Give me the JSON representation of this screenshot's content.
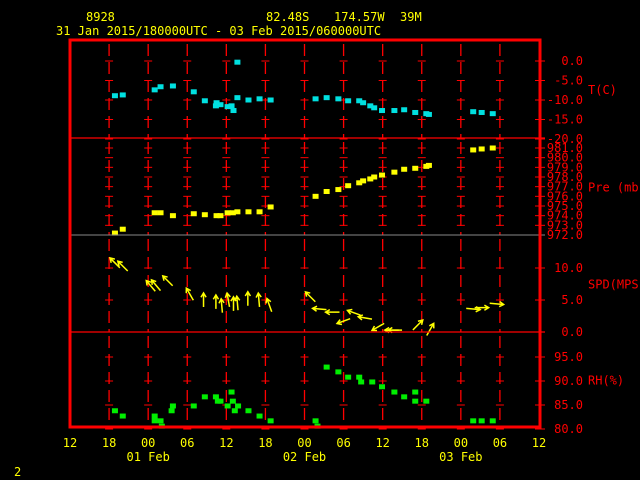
{
  "header": {
    "station": "8928",
    "latitude": "82.48S",
    "longitude": "174.57W",
    "elevation": "39M",
    "period": "31 Jan 2015/180000UTC - 03 Feb 2015/060000UTC"
  },
  "footer": {
    "page": "2"
  },
  "colors": {
    "frame": "#ff0000",
    "text": "#ffff00",
    "temperature": "#00e0e0",
    "pressure": "#ffff00",
    "wind": "#ffff00",
    "humidity": "#00ee00"
  },
  "chart_data": {
    "type": "scatter",
    "x_axis": {
      "range": [
        "2015-01-31 12:00",
        "2015-02-03 12:00"
      ],
      "tick_labels": [
        "12",
        "18",
        "00",
        "06",
        "12",
        "18",
        "00",
        "06",
        "12",
        "18",
        "00",
        "06",
        "12"
      ],
      "date_labels": [
        {
          "date": "2015-02-01 00:00",
          "label": "01 Feb"
        },
        {
          "date": "2015-02-02 00:00",
          "label": "02 Feb"
        },
        {
          "date": "2015-02-03 00:00",
          "label": "03 Feb"
        }
      ]
    },
    "panels": [
      {
        "key": "temperature",
        "ylabel": "T(C)",
        "ylim": [
          -20,
          0
        ],
        "ticks": [
          "0.0",
          "-5.0",
          "-10.0",
          "-15.0",
          "-20.0"
        ],
        "tick_values": [
          0,
          -5,
          -10,
          -15,
          -20
        ],
        "marker": "square",
        "points": [
          [
            "2015-01-31 18:54",
            -8.9
          ],
          [
            "2015-01-31 20:06",
            -8.7
          ],
          [
            "2015-02-01 01:00",
            -7.4
          ],
          [
            "2015-02-01 01:54",
            -6.6
          ],
          [
            "2015-02-01 03:48",
            -6.4
          ],
          [
            "2015-02-01 07:00",
            -7.9
          ],
          [
            "2015-02-01 08:42",
            -10.2
          ],
          [
            "2015-02-01 10:30",
            -10.7
          ],
          [
            "2015-02-01 10:24",
            -11.5
          ],
          [
            "2015-02-01 11:06",
            -11.2
          ],
          [
            "2015-02-01 12:12",
            -11.7
          ],
          [
            "2015-02-01 12:48",
            -11.5
          ],
          [
            "2015-02-01 13:06",
            -12.7
          ],
          [
            "2015-02-01 13:42",
            -0.3
          ],
          [
            "2015-02-01 13:42",
            -9.4
          ],
          [
            "2015-02-01 15:24",
            -10.0
          ],
          [
            "2015-02-01 17:06",
            -9.7
          ],
          [
            "2015-02-01 18:48",
            -10.0
          ],
          [
            "2015-02-02 01:42",
            -9.7
          ],
          [
            "2015-02-02 03:24",
            -9.4
          ],
          [
            "2015-02-02 05:12",
            -9.7
          ],
          [
            "2015-02-02 06:42",
            -10.2
          ],
          [
            "2015-02-02 08:24",
            -10.2
          ],
          [
            "2015-02-02 09:00",
            -10.7
          ],
          [
            "2015-02-02 10:06",
            -11.5
          ],
          [
            "2015-02-02 10:42",
            -12.0
          ],
          [
            "2015-02-02 11:54",
            -12.7
          ],
          [
            "2015-02-02 13:48",
            -12.7
          ],
          [
            "2015-02-02 15:18",
            -12.5
          ],
          [
            "2015-02-02 17:00",
            -13.2
          ],
          [
            "2015-02-02 18:42",
            -13.5
          ],
          [
            "2015-02-02 19:06",
            -13.7
          ],
          [
            "2015-02-03 01:54",
            -13.0
          ],
          [
            "2015-02-03 03:12",
            -13.2
          ],
          [
            "2015-02-03 04:54",
            -13.5
          ]
        ]
      },
      {
        "key": "pressure",
        "ylabel": "Pre (mb)",
        "ylim": [
          972,
          981
        ],
        "ticks": [
          "981.0",
          "980.0",
          "979.0",
          "978.0",
          "977.0",
          "976.0",
          "975.0",
          "974.0",
          "973.0",
          "972.0"
        ],
        "tick_values": [
          981,
          980,
          979,
          978,
          977,
          976,
          975,
          974,
          973,
          972
        ],
        "marker": "square",
        "points": [
          [
            "2015-01-31 18:54",
            972.2
          ],
          [
            "2015-01-31 20:06",
            972.6
          ],
          [
            "2015-02-01 01:00",
            974.3
          ],
          [
            "2015-02-01 01:54",
            974.3
          ],
          [
            "2015-02-01 03:48",
            974.0
          ],
          [
            "2015-02-01 07:00",
            974.2
          ],
          [
            "2015-02-01 08:42",
            974.1
          ],
          [
            "2015-02-01 10:30",
            974.0
          ],
          [
            "2015-02-01 11:06",
            974.0
          ],
          [
            "2015-02-01 12:12",
            974.3
          ],
          [
            "2015-02-01 13:00",
            974.3
          ],
          [
            "2015-02-01 13:42",
            974.4
          ],
          [
            "2015-02-01 15:24",
            974.4
          ],
          [
            "2015-02-01 17:06",
            974.4
          ],
          [
            "2015-02-01 18:48",
            974.9
          ],
          [
            "2015-02-02 01:42",
            976.0
          ],
          [
            "2015-02-02 03:24",
            976.5
          ],
          [
            "2015-02-02 05:12",
            976.7
          ],
          [
            "2015-02-02 06:42",
            977.1
          ],
          [
            "2015-02-02 08:24",
            977.4
          ],
          [
            "2015-02-02 09:00",
            977.6
          ],
          [
            "2015-02-02 10:06",
            977.8
          ],
          [
            "2015-02-02 10:42",
            978.0
          ],
          [
            "2015-02-02 11:54",
            978.2
          ],
          [
            "2015-02-02 13:48",
            978.5
          ],
          [
            "2015-02-02 15:18",
            978.8
          ],
          [
            "2015-02-02 17:00",
            978.9
          ],
          [
            "2015-02-02 18:42",
            979.1
          ],
          [
            "2015-02-02 19:06",
            979.2
          ],
          [
            "2015-02-03 01:54",
            980.8
          ],
          [
            "2015-02-03 03:12",
            980.9
          ],
          [
            "2015-02-03 04:54",
            981.0
          ]
        ]
      },
      {
        "key": "wind",
        "ylabel": "SPD(MPS)",
        "ylim": [
          0,
          15
        ],
        "ticks": [
          "10.0",
          "5.0",
          "0.0"
        ],
        "tick_values": [
          10,
          5,
          0
        ],
        "marker": "arrow",
        "points": [
          [
            "2015-01-31 18:54",
            10.8,
            135
          ],
          [
            "2015-01-31 20:06",
            10.3,
            135
          ],
          [
            "2015-02-01 00:24",
            7.2,
            140
          ],
          [
            "2015-02-01 01:12",
            7.3,
            140
          ],
          [
            "2015-02-01 03:00",
            8.0,
            135
          ],
          [
            "2015-02-01 06:24",
            5.9,
            150
          ],
          [
            "2015-02-01 08:30",
            5.0,
            180
          ],
          [
            "2015-02-01 10:24",
            4.7,
            180
          ],
          [
            "2015-02-01 11:18",
            4.1,
            175
          ],
          [
            "2015-02-01 12:18",
            5.0,
            170
          ],
          [
            "2015-02-01 13:06",
            4.4,
            180
          ],
          [
            "2015-02-01 13:42",
            4.5,
            175
          ],
          [
            "2015-02-01 15:18",
            5.2,
            180
          ],
          [
            "2015-02-01 17:00",
            5.0,
            175
          ],
          [
            "2015-02-01 18:36",
            4.2,
            160
          ],
          [
            "2015-02-02 00:54",
            5.5,
            135
          ],
          [
            "2015-02-02 02:18",
            3.6,
            95
          ],
          [
            "2015-02-02 04:18",
            3.1,
            90
          ],
          [
            "2015-02-02 06:00",
            1.7,
            70
          ],
          [
            "2015-02-02 07:36",
            3.0,
            110
          ],
          [
            "2015-02-02 09:18",
            2.2,
            100
          ],
          [
            "2015-02-02 11:18",
            0.8,
            60
          ],
          [
            "2015-02-02 13:24",
            0.3,
            90
          ],
          [
            "2015-02-02 13:54",
            0.3,
            90
          ],
          [
            "2015-02-02 17:24",
            1.1,
            225
          ],
          [
            "2015-02-02 19:18",
            0.4,
            210
          ],
          [
            "2015-02-03 01:54",
            3.6,
            275
          ],
          [
            "2015-02-03 03:12",
            3.8,
            270
          ],
          [
            "2015-02-03 05:30",
            4.4,
            275
          ]
        ]
      },
      {
        "key": "humidity",
        "ylabel": "RH(%)",
        "ylim": [
          80,
          100
        ],
        "ticks": [
          "95.0",
          "90.0",
          "85.0",
          "80.0"
        ],
        "tick_values": [
          95,
          90,
          85,
          80
        ],
        "marker": "square",
        "points": [
          [
            "2015-01-31 18:54",
            83.8
          ],
          [
            "2015-01-31 20:06",
            82.7
          ],
          [
            "2015-02-01 01:00",
            82.7
          ],
          [
            "2015-02-01 01:00",
            81.7
          ],
          [
            "2015-02-01 01:54",
            81.7
          ],
          [
            "2015-02-01 02:06",
            80.6
          ],
          [
            "2015-02-01 03:48",
            84.8
          ],
          [
            "2015-02-01 03:36",
            83.8
          ],
          [
            "2015-02-01 07:00",
            84.8
          ],
          [
            "2015-02-01 08:42",
            86.7
          ],
          [
            "2015-02-01 10:24",
            86.7
          ],
          [
            "2015-02-01 10:42",
            85.8
          ],
          [
            "2015-02-01 11:06",
            85.8
          ],
          [
            "2015-02-01 12:48",
            87.7
          ],
          [
            "2015-02-01 13:00",
            85.8
          ],
          [
            "2015-02-01 12:12",
            84.8
          ],
          [
            "2015-02-01 13:18",
            83.8
          ],
          [
            "2015-02-01 13:48",
            84.8
          ],
          [
            "2015-02-01 15:24",
            83.8
          ],
          [
            "2015-02-01 17:06",
            82.7
          ],
          [
            "2015-02-01 18:48",
            81.7
          ],
          [
            "2015-02-02 01:42",
            81.7
          ],
          [
            "2015-02-02 02:00",
            80.6
          ],
          [
            "2015-02-02 03:24",
            92.9
          ],
          [
            "2015-02-02 05:12",
            91.9
          ],
          [
            "2015-02-02 06:42",
            90.8
          ],
          [
            "2015-02-02 08:24",
            90.8
          ],
          [
            "2015-02-02 08:42",
            89.8
          ],
          [
            "2015-02-02 10:24",
            89.8
          ],
          [
            "2015-02-02 11:54",
            88.8
          ],
          [
            "2015-02-02 13:48",
            87.7
          ],
          [
            "2015-02-02 15:18",
            86.7
          ],
          [
            "2015-02-02 17:00",
            87.7
          ],
          [
            "2015-02-02 17:00",
            85.8
          ],
          [
            "2015-02-02 18:42",
            85.8
          ],
          [
            "2015-02-03 01:54",
            81.7
          ],
          [
            "2015-02-03 03:12",
            81.7
          ],
          [
            "2015-02-03 04:54",
            81.7
          ]
        ]
      }
    ]
  }
}
